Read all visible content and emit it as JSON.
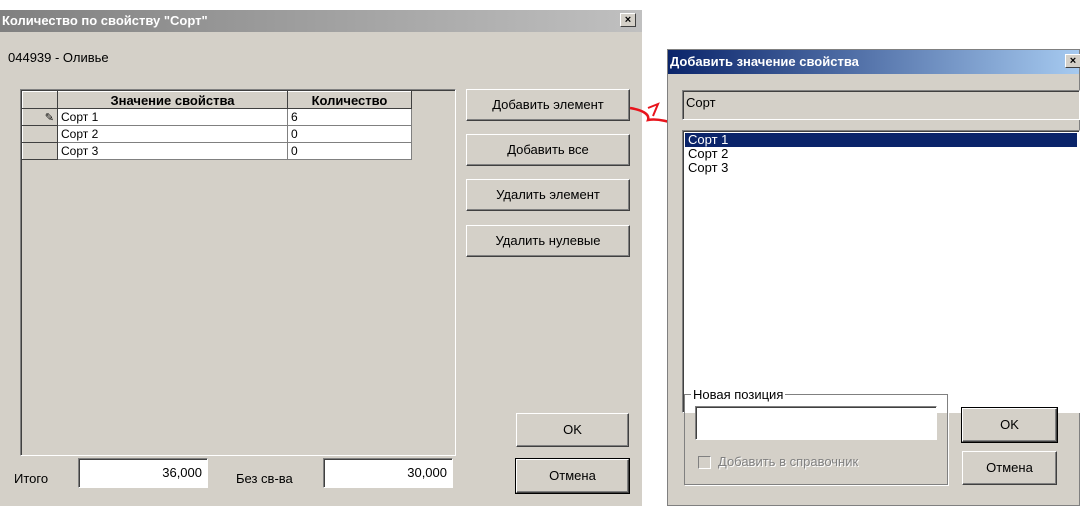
{
  "dialog1": {
    "title": "Количество по свойству \"Сорт\"",
    "close": "×",
    "product": "044939 - Оливье",
    "columns": [
      "Значение свойства",
      "Количество"
    ],
    "rows": [
      {
        "name": "Сорт 1",
        "qty": "6"
      },
      {
        "name": "Сорт 2",
        "qty": "0"
      },
      {
        "name": "Сорт 3",
        "qty": "0"
      }
    ],
    "buttons": {
      "add_element": "Добавить элемент",
      "add_all": "Добавить все",
      "delete_element": "Удалить элемент",
      "delete_zero": "Удалить нулевые",
      "ok": "OK",
      "cancel": "Отмена"
    },
    "total_label": "Итого",
    "total_value": "36,000",
    "without_label": "Без св-ва",
    "without_value": "30,000"
  },
  "dialog2": {
    "title": "Добавить значение свойства",
    "close": "×",
    "property": "Сорт",
    "items": [
      "Сорт 1",
      "Сорт 2",
      "Сорт 3"
    ],
    "selected_index": 0,
    "new_position_label": "Новая позиция",
    "new_position_value": "",
    "add_to_directory": "Добавить в справочник",
    "ok": "OK",
    "cancel": "Отмена"
  },
  "colors": {
    "arrow": "#e8141c",
    "selection": "#0a246a"
  }
}
